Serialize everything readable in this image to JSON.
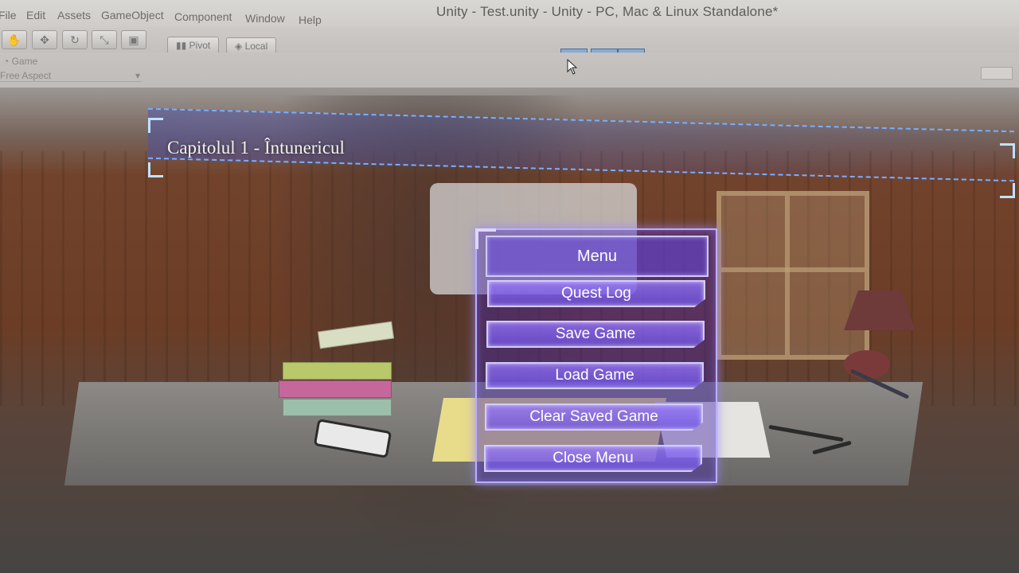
{
  "editor": {
    "menus": [
      "File",
      "Edit",
      "Assets",
      "GameObject",
      "Component",
      "Window",
      "Help"
    ],
    "window_title": "Unity - Test.unity - Unity - PC, Mac & Linux Standalone*",
    "toolbar": {
      "pivot_label": "Pivot",
      "local_label": "Local"
    },
    "game_view": {
      "tab_label": "Game",
      "aspect_label": "Free Aspect"
    }
  },
  "game": {
    "chapter_title": "Capitolul 1 - Întunericul",
    "menu": {
      "header": "Menu",
      "buttons": [
        "Quest Log",
        "Save Game",
        "Load Game",
        "Clear Saved Game",
        "Close Menu"
      ]
    }
  },
  "colors": {
    "menu_panel": "#4022aa",
    "menu_border": "#b9b0ff",
    "hud_line": "#7aaeff",
    "play_button": "#5a86b8"
  }
}
